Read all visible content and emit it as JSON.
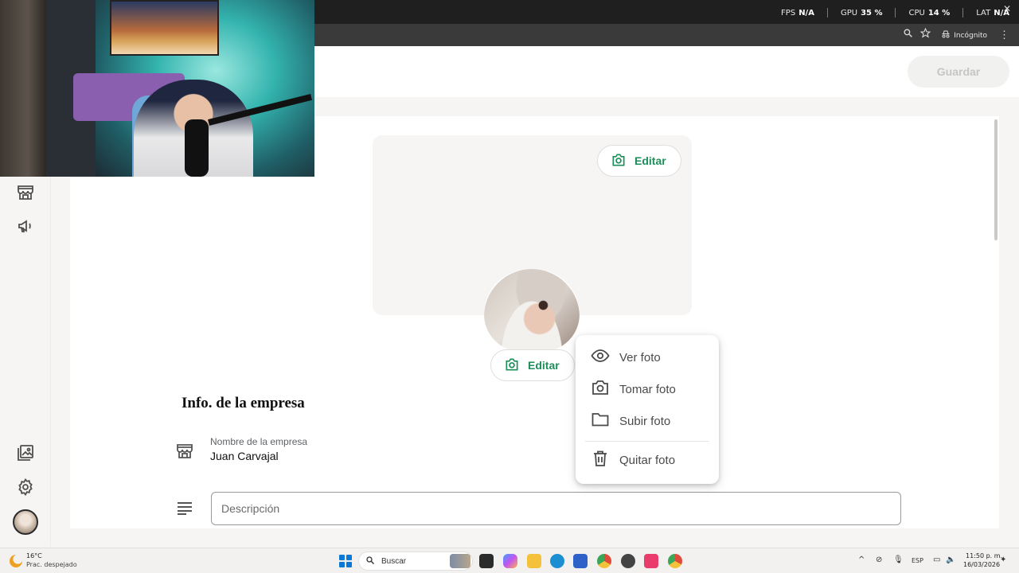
{
  "overlay": {
    "perf": [
      {
        "label": "FPS",
        "value": "N/A"
      },
      {
        "label": "GPU",
        "value": "35 %"
      },
      {
        "label": "CPU",
        "value": "14 %"
      },
      {
        "label": "LAT",
        "value": "N/A"
      }
    ]
  },
  "browser": {
    "incognito_label": "Incógnito"
  },
  "header": {
    "save_label": "Guardar"
  },
  "rail": {
    "items": [
      "store-icon",
      "megaphone-icon",
      "gallery-icon",
      "gear-icon"
    ]
  },
  "profile": {
    "cover_edit_label": "Editar",
    "avatar_edit_label": "Editar",
    "section_title": "Info. de la empresa",
    "company_name_label": "Nombre de la empresa",
    "company_name_value": "Juan Carvajal",
    "description_placeholder": "Descripción"
  },
  "photo_menu": {
    "items": [
      {
        "label": "Ver foto",
        "icon": "eye-icon"
      },
      {
        "label": "Tomar foto",
        "icon": "camera-icon"
      },
      {
        "label": "Subir foto",
        "icon": "folder-icon"
      },
      {
        "label": "Quitar foto",
        "icon": "trash-icon"
      }
    ]
  },
  "taskbar": {
    "weather_temp": "16°C",
    "weather_desc": "Prac. despejado",
    "search_label": "Buscar",
    "language": "ESP",
    "time": "11:50 p. m.",
    "date": "16/03/2026"
  },
  "colors": {
    "accent_green": "#1e8e5a",
    "windows_blue": "#0a78d7"
  }
}
